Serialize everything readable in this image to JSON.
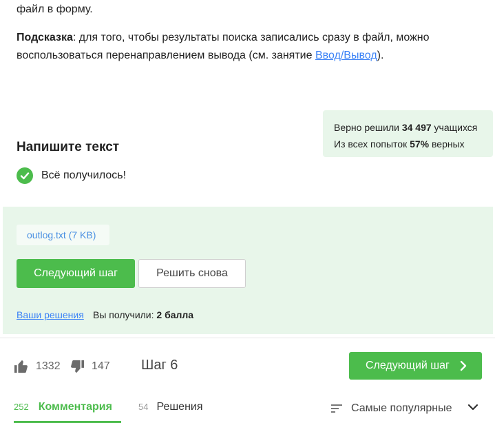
{
  "lesson": {
    "text_line1": "файл в форму.",
    "hint_label": "Подсказка",
    "hint_text": ": для того, чтобы результаты поиска записались сразу в файл, можно воспользоваться перенаправлением вывода (см. занятие ",
    "hint_link": "Ввод/Вывод",
    "hint_end": ")."
  },
  "stats": {
    "solved_prefix": "Верно решили ",
    "solved_count": "34 497",
    "solved_suffix": " учащихся",
    "attempts_prefix": "Из всех попыток ",
    "attempts_percent": "57%",
    "attempts_suffix": " верных"
  },
  "task": {
    "title": "Напишите текст",
    "success_text": "Всё получилось!"
  },
  "submission": {
    "file_chip": "outlog.txt (7 KB)",
    "next_button": "Следующий шаг",
    "retry_button": "Решить снова",
    "your_solutions_link": "Ваши решения",
    "score_prefix": "Вы получили: ",
    "score_value": "2 балла"
  },
  "footer": {
    "likes": "1332",
    "dislikes": "147",
    "step_label": "Шаг 6",
    "next_step_button": "Следующий шаг"
  },
  "tabs": {
    "comments_count": "252",
    "comments_label": "Комментария",
    "solutions_count": "54",
    "solutions_label": "Решения"
  },
  "sort": {
    "label": "Самые популярные"
  },
  "colors": {
    "accent_green": "#4cbc4c",
    "panel_green": "#e8f6ea",
    "link_blue": "#3b82f6"
  },
  "icons": [
    "check-icon",
    "thumbs-up-icon",
    "thumbs-down-icon",
    "chevron-right-icon",
    "sort-icon",
    "chevron-down-icon"
  ]
}
